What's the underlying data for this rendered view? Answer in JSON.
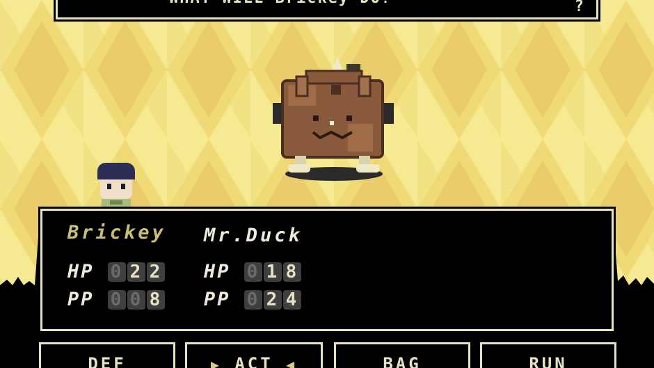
{
  "message": {
    "text": "WHAT WILL Brickey DO?",
    "more_prompt": "?"
  },
  "enemy": {
    "name": "Brickey",
    "icon": "brick-enemy-sprite"
  },
  "player": {
    "icon": "boy-player-sprite"
  },
  "party": [
    {
      "name": "Brickey",
      "hp_label": "HP",
      "hp": [
        "0",
        "2",
        "2"
      ],
      "pp_label": "PP",
      "pp": [
        "0",
        "0",
        "8"
      ],
      "color": "#c9c078"
    },
    {
      "name": "Mr.Duck",
      "hp_label": "HP",
      "hp": [
        "0",
        "1",
        "8"
      ],
      "pp_label": "PP",
      "pp": [
        "0",
        "2",
        "4"
      ],
      "color": "#efeadb"
    }
  ],
  "commands": [
    {
      "label": "DEF",
      "selected": false
    },
    {
      "label": "ACT",
      "selected": true
    },
    {
      "label": "BAG",
      "selected": false
    },
    {
      "label": "RUN",
      "selected": false
    }
  ],
  "colors": {
    "bg_light": "#f3e98b",
    "bg_mid": "#e8c755",
    "accent": "#c9c078",
    "frame": "#e8e2c4"
  }
}
